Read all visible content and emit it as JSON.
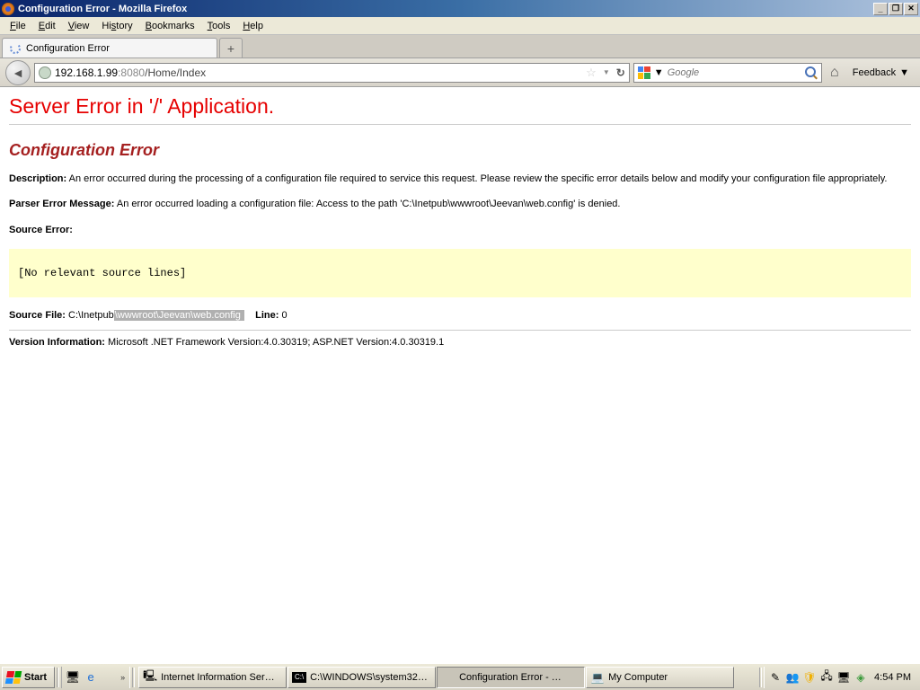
{
  "window": {
    "title": "Configuration Error - Mozilla Firefox"
  },
  "menubar": {
    "file": "File",
    "edit": "Edit",
    "view": "View",
    "history": "History",
    "bookmarks": "Bookmarks",
    "tools": "Tools",
    "help": "Help"
  },
  "tab": {
    "label": "Configuration Error"
  },
  "nav": {
    "url_host": "192.168.1.99",
    "url_port": ":8080",
    "url_path": "/Home/Index",
    "search_placeholder": "Google",
    "feedback": "Feedback"
  },
  "error": {
    "h1": "Server Error in '/' Application.",
    "h2": "Configuration Error",
    "desc_label": "Description:",
    "desc_text": " An error occurred during the processing of a configuration file required to service this request. Please review the specific error details below and modify your configuration file appropriately.",
    "parser_label": "Parser Error Message:",
    "parser_text": " An error occurred loading a configuration file: Access to the path 'C:\\Inetpub\\wwwroot\\Jeevan\\web.config' is denied.",
    "source_error_label": "Source Error:",
    "source_box": "[No relevant source lines]",
    "source_file_label": "Source File:",
    "source_file_pre": " C:\\Inetpub",
    "source_file_hl": "\\wwwroot\\Jeevan\\web.config ",
    "line_label": "Line:",
    "line_value": " 0",
    "version_label": "Version Information:",
    "version_text": " Microsoft .NET Framework Version:4.0.30319; ASP.NET Version:4.0.30319.1"
  },
  "taskbar": {
    "start": "Start",
    "items": {
      "iis": "Internet Information Ser…",
      "cmd": "C:\\WINDOWS\\system32…",
      "ff": "Configuration Error - …",
      "mycomp": "My Computer"
    },
    "clock": "4:54 PM"
  }
}
